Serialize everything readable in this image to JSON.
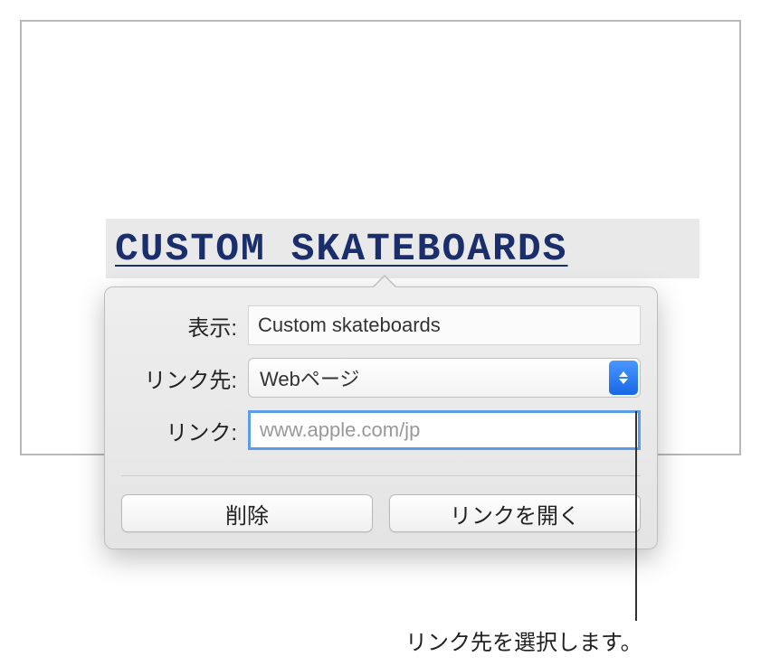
{
  "document": {
    "linked_text": "CUSTOM SKATEBOARDS"
  },
  "popover": {
    "display_label": "表示:",
    "display_value": "Custom skateboards",
    "link_to_label": "リンク先:",
    "link_to_value": "Webページ",
    "link_label": "リンク:",
    "link_placeholder": "www.apple.com/jp",
    "link_value": "",
    "buttons": {
      "delete": "削除",
      "open": "リンクを開く"
    }
  },
  "callout": {
    "text": "リンク先を選択します。"
  }
}
